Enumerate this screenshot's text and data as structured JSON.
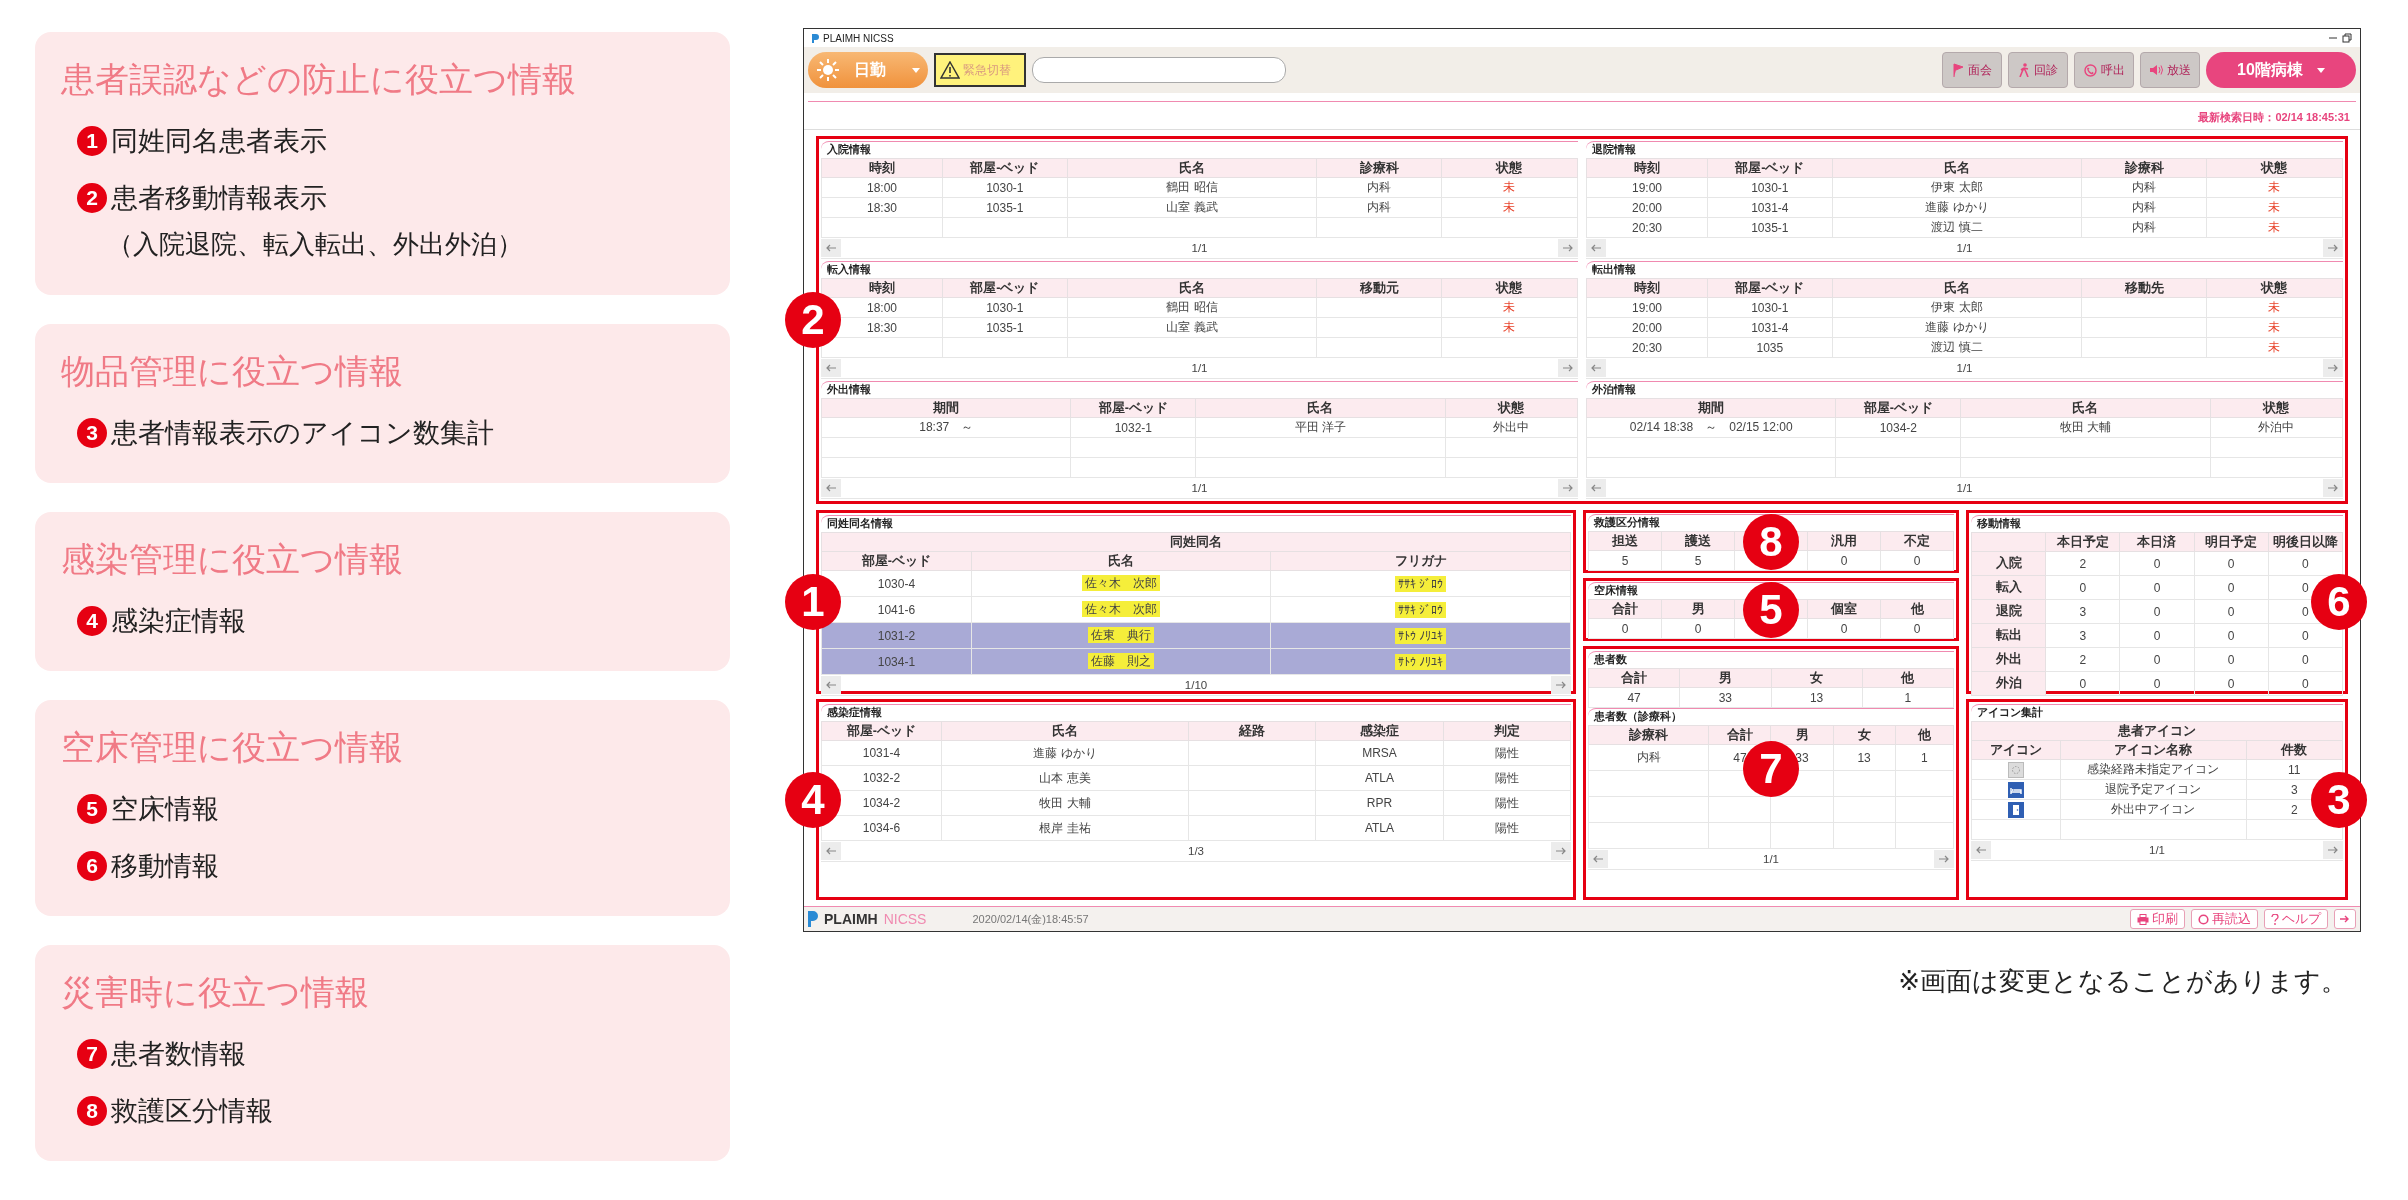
{
  "features": [
    {
      "title": "患者誤認などの防止に役立つ情報",
      "items": [
        {
          "number": "1",
          "label": "同姓同名患者表示"
        },
        {
          "number": "2",
          "label": "患者移動情報表示",
          "note": "（入院退院、転入転出、外出外泊）"
        }
      ]
    },
    {
      "title": "物品管理に役立つ情報",
      "items": [
        {
          "number": "3",
          "label": "患者情報表示のアイコン数集計"
        }
      ]
    },
    {
      "title": "感染管理に役立つ情報",
      "items": [
        {
          "number": "4",
          "label": "感染症情報"
        }
      ]
    },
    {
      "title": "空床管理に役立つ情報",
      "items": [
        {
          "number": "5",
          "label": "空床情報"
        },
        {
          "number": "6",
          "label": "移動情報"
        }
      ]
    },
    {
      "title": "災害時に役立つ情報",
      "items": [
        {
          "number": "7",
          "label": "患者数情報"
        },
        {
          "number": "8",
          "label": "救護区分情報"
        }
      ]
    }
  ],
  "app": {
    "window_title": "PLAIMH NICSS",
    "toolbar": {
      "shift": "日勤",
      "emergency": "緊急切替",
      "actions": [
        "面会",
        "回診",
        "呼出",
        "放送"
      ],
      "ward": "10階病棟"
    },
    "last_search": "最新検索日時：02/14 18:45:31",
    "movement_area": {
      "callout": "2",
      "columns": [
        [
          {
            "kind": "list",
            "title": "入院情報",
            "columns": [
              "時刻",
              "部屋-ベッド",
              "氏名",
              "診療科",
              "状態"
            ],
            "rows": [
              {
                "cells": [
                  "18:00",
                  "1030-1",
                  "鶴田 昭信",
                  "内科",
                  "未"
                ],
                "pending": true
              },
              {
                "cells": [
                  "18:30",
                  "1035-1",
                  "山室 義武",
                  "内科",
                  "未"
                ],
                "pending": true
              }
            ],
            "page": "1/1"
          },
          {
            "kind": "list",
            "title": "転入情報",
            "columns": [
              "時刻",
              "部屋-ベッド",
              "氏名",
              "移動元",
              "状態"
            ],
            "rows": [
              {
                "cells": [
                  "18:00",
                  "1030-1",
                  "鶴田 昭信",
                  null,
                  "未"
                ],
                "pending": true
              },
              {
                "cells": [
                  "18:30",
                  "1035-1",
                  "山室 義武",
                  null,
                  "未"
                ],
                "pending": true
              }
            ],
            "page": "1/1"
          },
          {
            "kind": "list",
            "title": "外出情報",
            "columns": [
              "期間",
              "部屋-ベッド",
              "氏名",
              "状態"
            ],
            "rows": [
              {
                "cells": [
                  "18:37　～",
                  "1032-1",
                  "平田 洋子",
                  "外出中"
                ],
                "pending": false
              }
            ],
            "page": "1/1"
          }
        ],
        [
          {
            "kind": "list",
            "title": "退院情報",
            "columns": [
              "時刻",
              "部屋-ベッド",
              "氏名",
              "診療科",
              "状態"
            ],
            "rows": [
              {
                "cells": [
                  "19:00",
                  "1030-1",
                  "伊東 太郎",
                  "内科",
                  "未"
                ],
                "pending": true
              },
              {
                "cells": [
                  "20:00",
                  "1031-4",
                  "進藤 ゆかり",
                  "内科",
                  "未"
                ],
                "pending": true
              },
              {
                "cells": [
                  "20:30",
                  "1035-1",
                  "渡辺 慎二",
                  "内科",
                  "未"
                ],
                "pending": true
              }
            ],
            "page": "1/1"
          },
          {
            "kind": "list",
            "title": "転出情報",
            "columns": [
              "時刻",
              "部屋-ベッド",
              "氏名",
              "移動先",
              "状態"
            ],
            "rows": [
              {
                "cells": [
                  "19:00",
                  "1030-1",
                  "伊東 太郎",
                  null,
                  "未"
                ],
                "pending": true
              },
              {
                "cells": [
                  "20:00",
                  "1031-4",
                  "進藤 ゆかり",
                  null,
                  "未"
                ],
                "pending": true
              },
              {
                "cells": [
                  "20:30",
                  "1035",
                  "渡辺 慎二",
                  null,
                  "未"
                ],
                "pending": true
              }
            ],
            "page": "1/1"
          },
          {
            "kind": "list",
            "title": "外泊情報",
            "columns": [
              "期間",
              "部屋-ベッド",
              "氏名",
              "状態"
            ],
            "rows": [
              {
                "cells": [
                  "02/14 18:38　～　02/15 12:00",
                  "1034-2",
                  "牧田 大輔",
                  "外泊中"
                ],
                "pending": false
              }
            ],
            "page": "1/1"
          }
        ]
      ]
    },
    "same_name": {
      "callout": "1",
      "kind": "same_name",
      "title": "同姓同名情報",
      "group": "同姓同名",
      "columns": [
        "部屋-ベッド",
        "氏名",
        "フリガナ"
      ],
      "rows": [
        {
          "cells": [
            "1030-4",
            "佐々木　次郎",
            "ｻｻｷ ｼﾞﾛｳ"
          ],
          "selected": false
        },
        {
          "cells": [
            "1041-6",
            "佐々木　次郎",
            "ｻｻｷ ｼﾞﾛｳ"
          ],
          "selected": false
        },
        {
          "cells": [
            "1031-2",
            "佐東　典行",
            "ｻﾄｳ ﾉﾘﾕｷ"
          ],
          "selected": true
        },
        {
          "cells": [
            "1034-1",
            "佐藤　則之",
            "ｻﾄｳ ﾉﾘﾕｷ"
          ],
          "selected": true
        }
      ],
      "page": "1/10"
    },
    "infection": {
      "callout": "4",
      "kind": "list",
      "title": "感染症情報",
      "columns": [
        "部屋-ベッド",
        "氏名",
        "経路",
        "感染症",
        "判定"
      ],
      "rows": [
        {
          "cells": [
            "1031-4",
            "進藤 ゆかり",
            null,
            "MRSA",
            "陽性"
          ]
        },
        {
          "cells": [
            "1032-2",
            "山本 恵美",
            null,
            "ATLA",
            "陽性"
          ]
        },
        {
          "cells": [
            "1034-2",
            "牧田 大輔",
            null,
            "RPR",
            "陽性"
          ]
        },
        {
          "cells": [
            "1034-6",
            "根岸 圭祐",
            null,
            "ATLA",
            "陽性"
          ]
        }
      ],
      "page": "1/3"
    },
    "rescue": {
      "callout": "8",
      "kind": "list",
      "title": "救護区分情報",
      "columns": [
        "担送",
        "護送",
        null,
        "汎用",
        "不定"
      ],
      "rows": [
        {
          "cells": [
            "5",
            "5",
            null,
            "0",
            "0"
          ]
        }
      ]
    },
    "vacancy": {
      "callout": "5",
      "kind": "list",
      "title": "空床情報",
      "columns": [
        "合計",
        "男",
        null,
        "個室",
        "他"
      ],
      "rows": [
        {
          "cells": [
            "0",
            "0",
            null,
            "0",
            "0"
          ]
        }
      ]
    },
    "census": {
      "callout": "7",
      "tables": [
        {
          "kind": "list",
          "title": "患者数",
          "columns": [
            "合計",
            "男",
            "女",
            "他"
          ],
          "rows": [
            {
              "cells": [
                "47",
                "33",
                "13",
                "1"
              ]
            }
          ]
        },
        {
          "kind": "list",
          "title": "患者数（診療科）",
          "columns": [
            "診療科",
            "合計",
            "男",
            "女",
            "他"
          ],
          "rows": [
            {
              "cells": [
                "内科",
                "47",
                "33",
                "13",
                "1"
              ]
            }
          ],
          "page": "1/1"
        }
      ]
    },
    "movement": {
      "callout": "6",
      "kind": "matrix",
      "title": "移動情報",
      "columns": [
        null,
        "本日予定",
        "本日済",
        "明日予定",
        "明後日以降"
      ],
      "rows": [
        {
          "cells": [
            "入院",
            "2",
            "0",
            "0",
            "0"
          ]
        },
        {
          "cells": [
            "転入",
            "0",
            "0",
            "0",
            "0"
          ]
        },
        {
          "cells": [
            "退院",
            "3",
            "0",
            "0",
            "0"
          ]
        },
        {
          "cells": [
            "転出",
            "3",
            "0",
            "0",
            "0"
          ]
        },
        {
          "cells": [
            "外出",
            "2",
            "0",
            "0",
            "0"
          ]
        },
        {
          "cells": [
            "外泊",
            "0",
            "0",
            "0",
            "0"
          ]
        }
      ]
    },
    "icon_summary": {
      "callout": "3",
      "kind": "icons",
      "title": "アイコン集計",
      "group": "患者アイコン",
      "columns": [
        "アイコン",
        "アイコン名称",
        "件数"
      ],
      "rows": [
        {
          "cells": [
            null,
            "感染経路未指定アイコン",
            "11"
          ]
        },
        {
          "cells": [
            null,
            "退院予定アイコン",
            "3"
          ]
        },
        {
          "cells": [
            null,
            "外出中アイコン",
            "2"
          ]
        }
      ],
      "page": "1/1"
    },
    "footer": {
      "brand": "PLAIMH",
      "product": "NICSS",
      "datetime": "2020/02/14(金)18:45:57",
      "buttons": [
        "印刷",
        "再読込",
        "ヘルプ"
      ]
    }
  },
  "footnote": "※画面は変更となることがあります。"
}
